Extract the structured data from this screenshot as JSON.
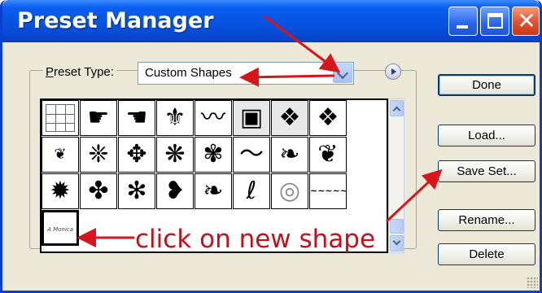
{
  "window": {
    "title": "Preset Manager"
  },
  "titlebar_buttons": {
    "close_glyph": "✕"
  },
  "preset_type": {
    "label_prefix": "P",
    "label_rest": "reset Type:",
    "selected": "Custom Shapes"
  },
  "buttons": {
    "done": "Done",
    "load": "Load...",
    "save_set": "Save Set...",
    "rename": "Rename...",
    "delete": "Delete"
  },
  "shapes": {
    "row1": [
      "grid",
      "☛",
      "☚",
      "⚜",
      "〰",
      "▣",
      "❖",
      "❖"
    ],
    "row2": [
      "❦",
      "❈",
      "✥",
      "❋",
      "✾",
      "〜",
      "❧",
      "❦"
    ],
    "row3": [
      "✹",
      "✤",
      "✻",
      "❥",
      "❧",
      "ℓ",
      "◎",
      "~~~~~"
    ],
    "new_shape_text": "A Monica Wilson"
  },
  "annotation": {
    "text": "click on new shape",
    "color": "#c4101a"
  },
  "colors": {
    "titlebar": "#0553e0",
    "dialog_bg": "#ece9d8",
    "close_button": "#e0502a",
    "arrow": "#d8141c"
  }
}
